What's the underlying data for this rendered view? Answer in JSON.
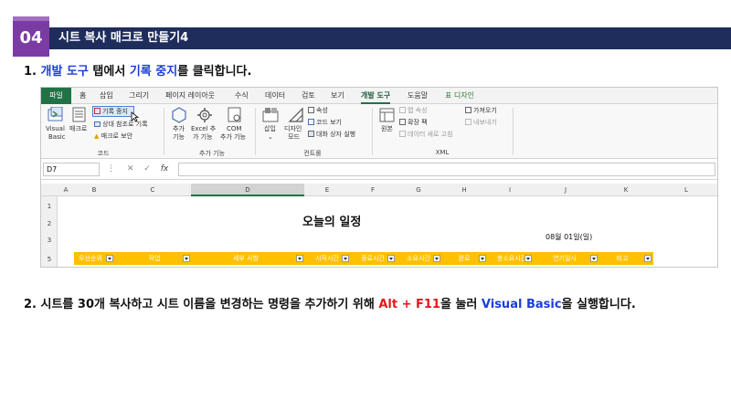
{
  "header": {
    "number": "04",
    "title": "시트 복사 매크로 만들기4"
  },
  "step1": {
    "num": "1.",
    "p1": "개발 도구",
    "p2": " 탭에서 ",
    "p3": "기록 중지",
    "p4": "를 클릭합니다."
  },
  "step2": {
    "num": "2.",
    "p1": "시트를 30개 복사하고 시트 이름을 변경하는 명령을 추가하기 위해 ",
    "p2": "Alt + F11",
    "p3": "을 눌러 ",
    "p4": "Visual Basic",
    "p5": "을 실행합니다."
  },
  "excel": {
    "tabs": [
      "파일",
      "홈",
      "삽입",
      "그리기",
      "페이지 레이아웃",
      "수식",
      "데이터",
      "검토",
      "보기",
      "개발 도구",
      "도움말",
      "표 디자인"
    ],
    "ribbon": {
      "visual_basic": [
        "Visual",
        "Basic"
      ],
      "macro": "매크로",
      "stop_recording": "기록 중지",
      "relative_ref": "상대 참조로 기록",
      "macro_security": "매크로 보안",
      "addins": [
        "추가",
        "기능"
      ],
      "excel_addins": [
        "Excel 추",
        "가 기능"
      ],
      "com_addins": [
        "COM",
        "추가 기능"
      ],
      "insert": "삽입",
      "design_mode": [
        "디자인",
        "모드"
      ],
      "properties": "속성",
      "view_code": "코드 보기",
      "run_dialog": "대화 상자 실행",
      "source": "원본",
      "map_properties": "맵 속성",
      "expansion_packs": "확장 팩",
      "refresh_data": "데이터 새로 고침",
      "import": "가져오기",
      "export": "내보내기",
      "groups": [
        "코드",
        "추가 기능",
        "컨트롤",
        "XML"
      ]
    },
    "namebox": "D7",
    "columns": [
      "A",
      "B",
      "C",
      "D",
      "E",
      "F",
      "G",
      "H",
      "I",
      "J",
      "K",
      "L"
    ],
    "rows": [
      "1",
      "2",
      "3",
      "5"
    ],
    "sheet_title": "오늘의 일정",
    "date": "08월 01일(일)",
    "headers": [
      "우선순위",
      "작업",
      "세부 사항",
      "시작시간",
      "종료시간",
      "소요시간",
      "완료",
      "총소요시간",
      "연기일시",
      "비고"
    ]
  }
}
